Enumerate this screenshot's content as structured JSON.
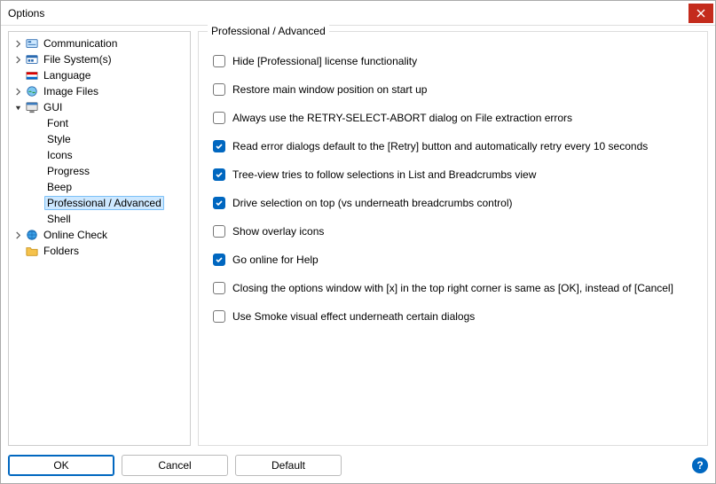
{
  "window": {
    "title": "Options"
  },
  "tree": {
    "items": [
      {
        "label": "Communication",
        "icon": "comm",
        "expander": "collapsed"
      },
      {
        "label": "File System(s)",
        "icon": "filesys",
        "expander": "collapsed"
      },
      {
        "label": "Language",
        "icon": "lang",
        "expander": "none"
      },
      {
        "label": "Image Files",
        "icon": "imgfiles",
        "expander": "collapsed"
      },
      {
        "label": "GUI",
        "icon": "gui",
        "expander": "expanded"
      },
      {
        "label": "Font",
        "icon": "none",
        "child": true
      },
      {
        "label": "Style",
        "icon": "none",
        "child": true
      },
      {
        "label": "Icons",
        "icon": "none",
        "child": true
      },
      {
        "label": "Progress",
        "icon": "none",
        "child": true
      },
      {
        "label": "Beep",
        "icon": "none",
        "child": true
      },
      {
        "label": "Professional / Advanced",
        "icon": "none",
        "child": true,
        "selected": true
      },
      {
        "label": "Shell",
        "icon": "none",
        "child": true
      },
      {
        "label": "Online Check",
        "icon": "online",
        "expander": "collapsed"
      },
      {
        "label": "Folders",
        "icon": "folder",
        "expander": "none"
      }
    ]
  },
  "panel": {
    "title": "Professional / Advanced",
    "options": [
      {
        "label": "Hide [Professional] license functionality",
        "checked": false
      },
      {
        "label": "Restore main window position on start up",
        "checked": false
      },
      {
        "label": "Always use the RETRY-SELECT-ABORT dialog on File extraction errors",
        "checked": false
      },
      {
        "label": "Read error dialogs default to the [Retry] button and automatically retry every 10 seconds",
        "checked": true
      },
      {
        "label": "Tree-view tries to follow selections in List and Breadcrumbs view",
        "checked": true
      },
      {
        "label": "Drive selection on top (vs underneath breadcrumbs control)",
        "checked": true
      },
      {
        "label": "Show overlay icons",
        "checked": false
      },
      {
        "label": "Go online for Help",
        "checked": true
      },
      {
        "label": "Closing the options window with [x] in the top right corner is same as [OK], instead of [Cancel]",
        "checked": false
      },
      {
        "label": "Use Smoke visual effect underneath certain dialogs",
        "checked": false
      }
    ]
  },
  "footer": {
    "ok": "OK",
    "cancel": "Cancel",
    "default": "Default",
    "help_glyph": "?"
  },
  "icons": {
    "chevron_right": ">",
    "chevron_down": "v"
  }
}
